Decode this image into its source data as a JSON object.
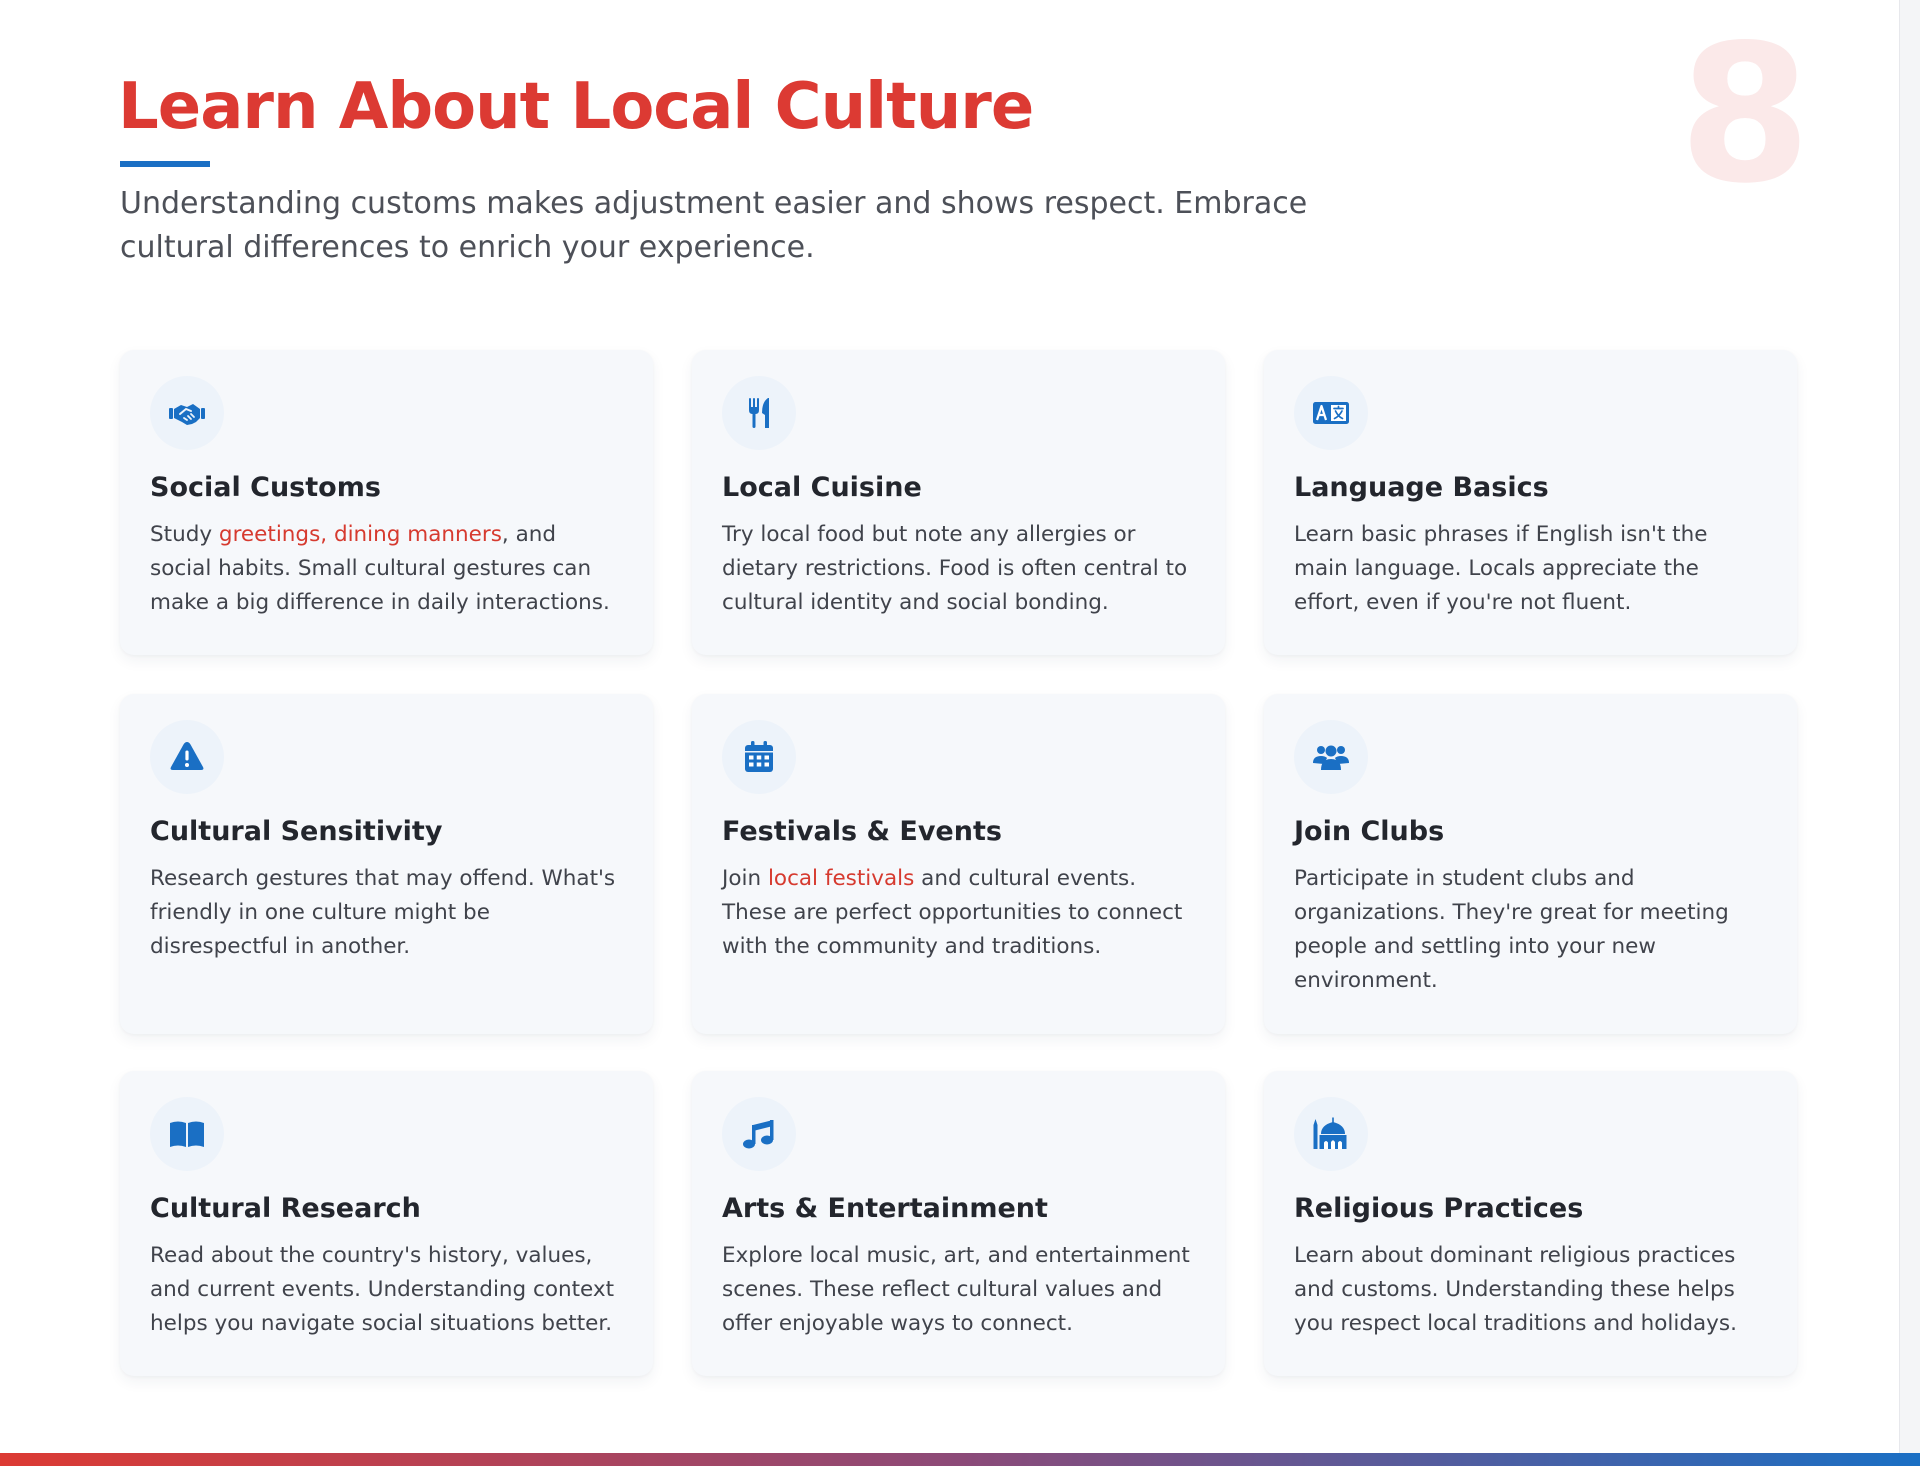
{
  "slide_number": "8",
  "title": "Learn About Local Culture",
  "subtitle": "Understanding customs makes adjustment easier and shows respect. Embrace cultural differences to enrich your experience.",
  "colors": {
    "title_red": "#dc3a33",
    "accent_blue": "#1a6fc4",
    "highlight_red": "#d63a2f",
    "card_background": "#f6f8fb"
  },
  "cards": [
    {
      "icon": "handshake-icon",
      "title": "Social Customs",
      "desc_before": "Study ",
      "desc_highlight": "greetings, dining manners",
      "desc_after": ", and social habits. Small cultural gestures can make a big difference in daily interactions."
    },
    {
      "icon": "utensils-icon",
      "title": "Local Cuisine",
      "desc_before": "Try local food but note any allergies or dietary restrictions. Food is often central to cultural identity and social bonding.",
      "desc_highlight": "",
      "desc_after": ""
    },
    {
      "icon": "language-icon",
      "title": "Language Basics",
      "desc_before": "Learn basic phrases if English isn't the main language. Locals appreciate the effort, even if you're not fluent.",
      "desc_highlight": "",
      "desc_after": ""
    },
    {
      "icon": "warning-triangle-icon",
      "title": "Cultural Sensitivity",
      "desc_before": "Research gestures that may offend. What's friendly in one culture might be disrespectful in another.",
      "desc_highlight": "",
      "desc_after": ""
    },
    {
      "icon": "calendar-icon",
      "title": "Festivals & Events",
      "desc_before": "Join ",
      "desc_highlight": "local festivals",
      "desc_after": " and cultural events. These are perfect opportunities to connect with the community and traditions."
    },
    {
      "icon": "users-group-icon",
      "title": "Join Clubs",
      "desc_before": "Participate in student clubs and organizations. They're great for meeting people and settling into your new environment.",
      "desc_highlight": "",
      "desc_after": ""
    },
    {
      "icon": "open-book-icon",
      "title": "Cultural Research",
      "desc_before": "Read about the country's history, values, and current events. Understanding context helps you navigate social situations better.",
      "desc_highlight": "",
      "desc_after": ""
    },
    {
      "icon": "music-note-icon",
      "title": "Arts & Entertainment",
      "desc_before": "Explore local music, art, and entertainment scenes. These reflect cultural values and offer enjoyable ways to connect.",
      "desc_highlight": "",
      "desc_after": ""
    },
    {
      "icon": "mosque-icon",
      "title": "Religious Practices",
      "desc_before": "Learn about dominant religious practices and customs. Understanding these helps you respect local traditions and holidays.",
      "desc_highlight": "",
      "desc_after": ""
    }
  ]
}
